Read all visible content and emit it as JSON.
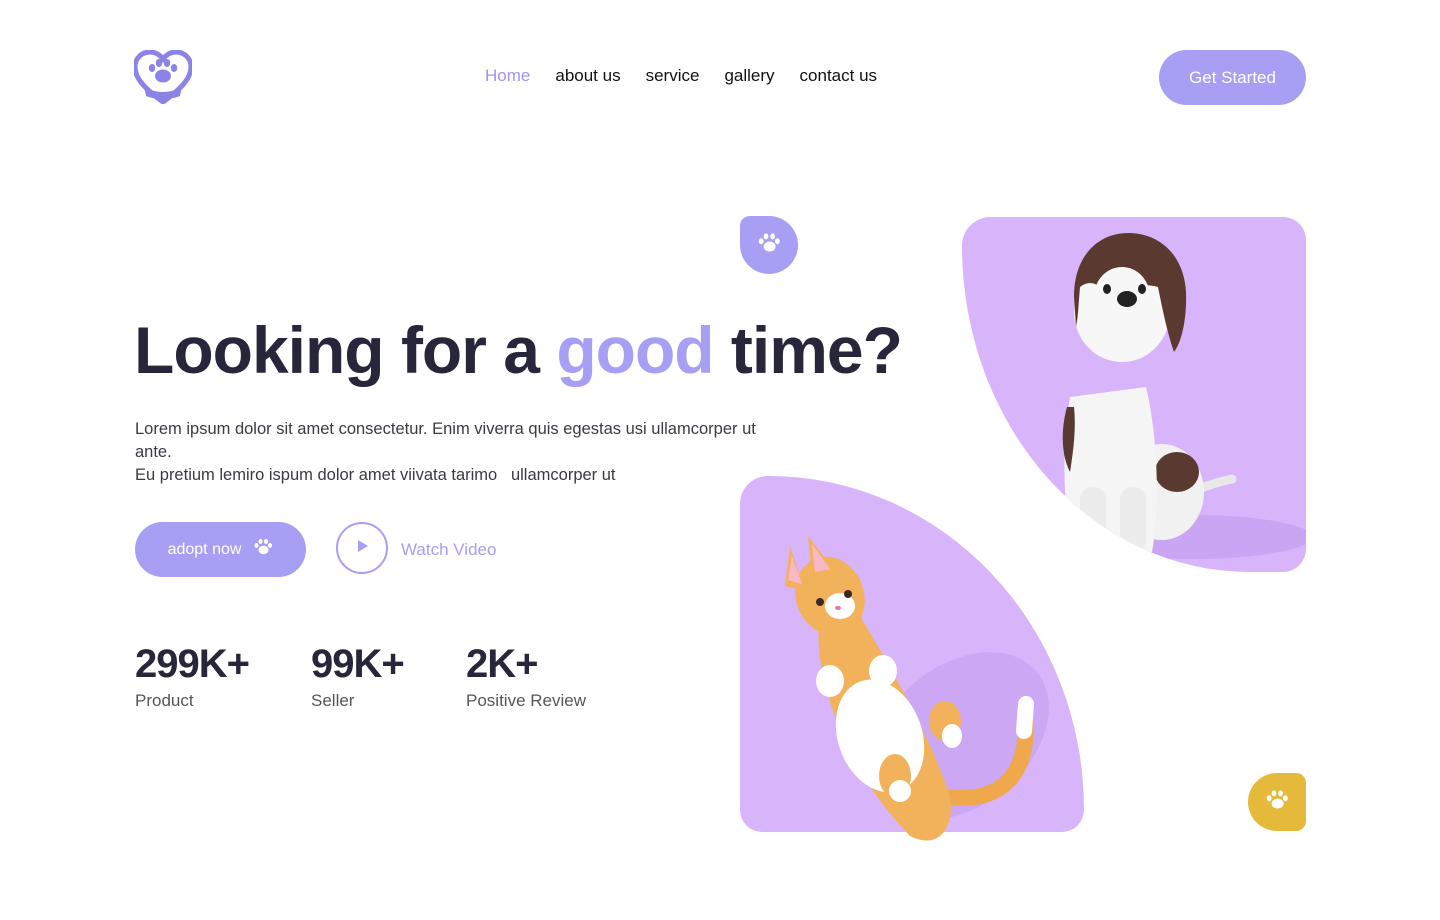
{
  "header": {
    "nav": [
      {
        "label": "Home",
        "active": true
      },
      {
        "label": "about us",
        "active": false
      },
      {
        "label": "service",
        "active": false
      },
      {
        "label": "gallery",
        "active": false
      },
      {
        "label": "contact us",
        "active": false
      }
    ],
    "cta_label": "Get Started"
  },
  "hero": {
    "title_before": "Looking for a ",
    "title_accent": "good",
    "title_after": " time?",
    "description_line1": "Lorem ipsum dolor sit amet consectetur. Enim viverra quis egestas usi ullamcorper ut ante.",
    "description_line2": "Eu pretium lemiro ispum dolor amet viivata tarimo   ullamcorper ut",
    "adopt_label": "adopt now",
    "watch_label": "Watch Video"
  },
  "stats": [
    {
      "value": "299K+",
      "label": "Product"
    },
    {
      "value": "99K+",
      "label": "Seller"
    },
    {
      "value": "2K+",
      "label": "Positive Review"
    }
  ],
  "icons": {
    "logo": "heart-paw-icon",
    "adopt": "paw-icon",
    "watch": "play-icon",
    "badge_top": "paw-icon",
    "badge_bottom": "paw-icon"
  },
  "colors": {
    "accent": "#a79ff4",
    "card": "#d8b4fb",
    "badge_yellow": "#e5b93a",
    "heading": "#27263a"
  }
}
